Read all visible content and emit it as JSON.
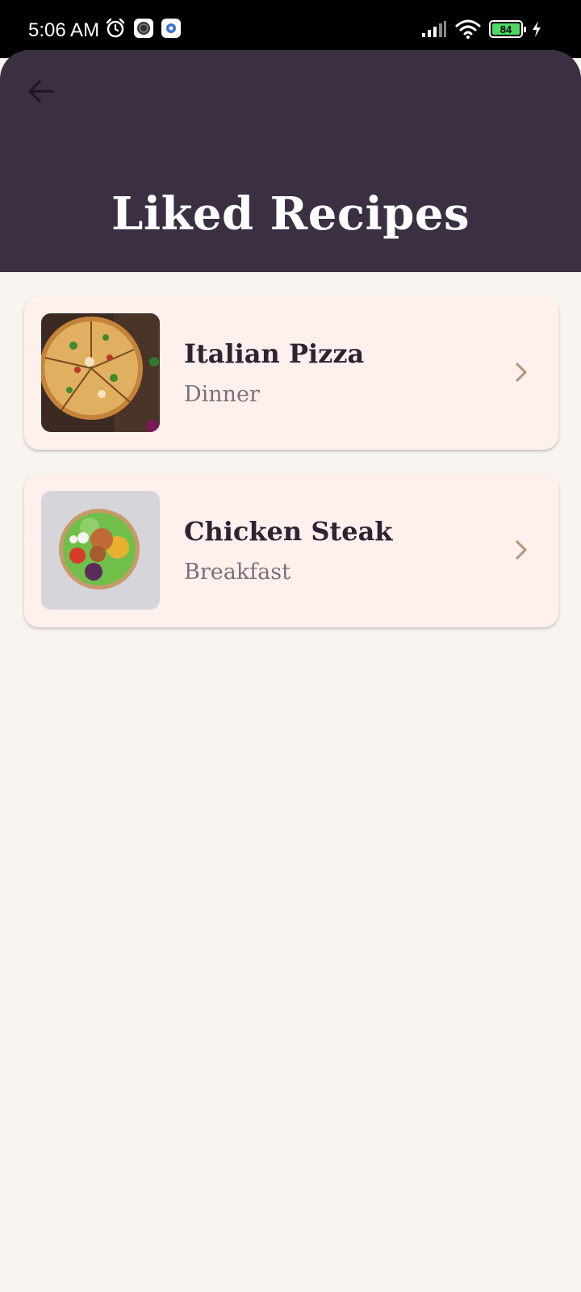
{
  "status_bar": {
    "time": "5:06 AM",
    "battery_level": "84",
    "icons": [
      "alarm-icon",
      "app-icon",
      "settings-app-icon",
      "signal-icon",
      "wifi-icon",
      "battery-icon",
      "charging-icon"
    ]
  },
  "header": {
    "title": "Liked Recipes",
    "back_icon": "arrow-left-icon",
    "background_color": "#3b2f42"
  },
  "recipes": [
    {
      "name": "Italian Pizza",
      "category": "Dinner",
      "image": "pizza-photo",
      "chevron_icon": "chevron-right-icon"
    },
    {
      "name": "Chicken Steak",
      "category": "Breakfast",
      "image": "salad-bowl-photo",
      "chevron_icon": "chevron-right-icon"
    }
  ],
  "colors": {
    "card_background": "#fdf0ed",
    "page_background": "#f8f4f0",
    "chevron": "#b89a7e"
  }
}
